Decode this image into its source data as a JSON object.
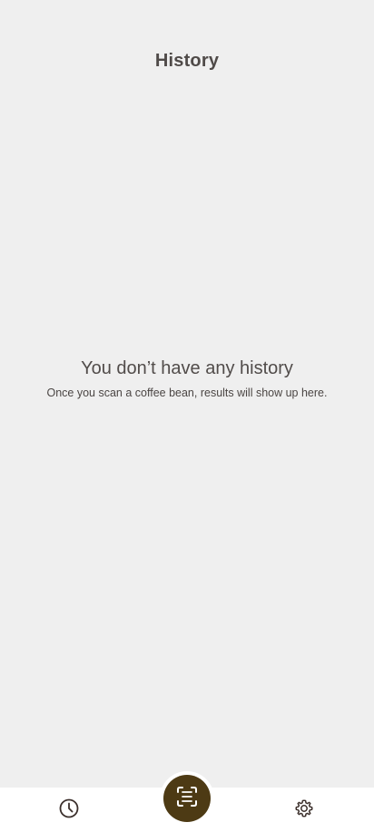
{
  "header": {
    "title": "History"
  },
  "empty_state": {
    "title": "You don’t have any history",
    "subtitle": "Once you scan a coffee bean, results will show up here."
  },
  "bottom_nav": {
    "items": [
      {
        "id": "history",
        "icon": "clock-icon"
      },
      {
        "id": "scan",
        "icon": "scan-icon"
      },
      {
        "id": "settings",
        "icon": "gear-icon"
      }
    ]
  },
  "colors": {
    "background": "#efefef",
    "nav_background": "#ffffff",
    "accent": "#4d3a14",
    "text_primary": "#4f4a48",
    "icon_color": "#3b2f2b"
  }
}
